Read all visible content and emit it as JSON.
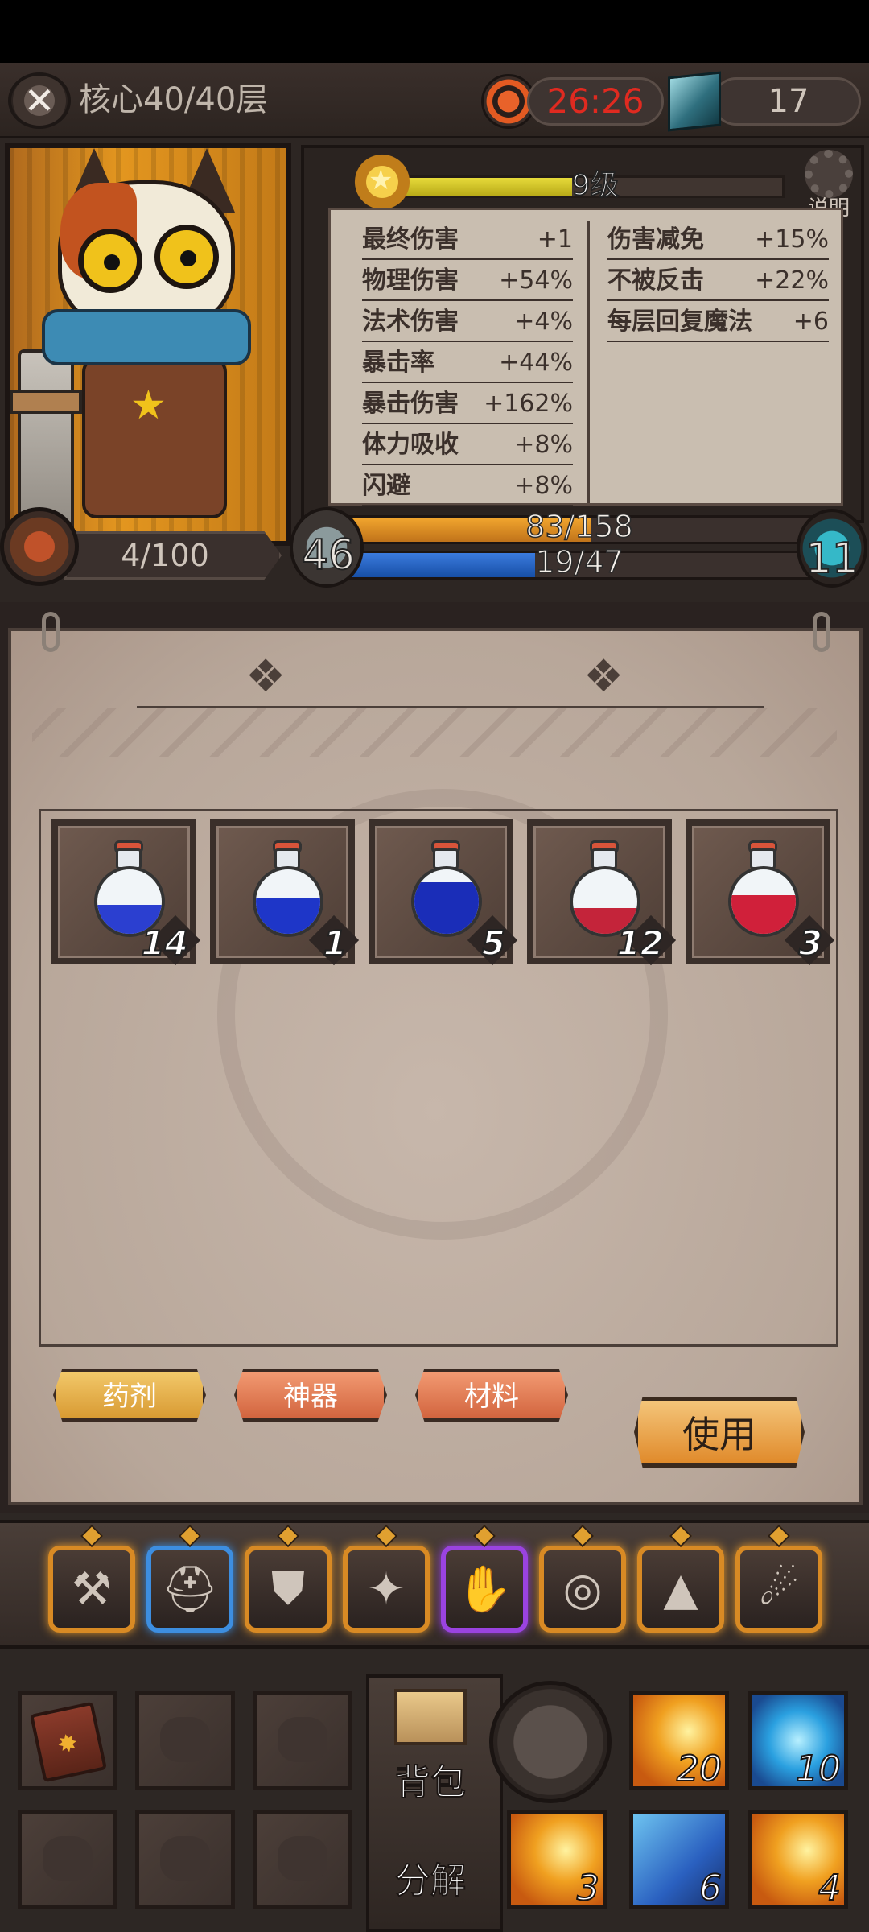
{
  "header": {
    "floor": "核心40/40层",
    "timer": "26:26",
    "gems": "17"
  },
  "character": {
    "level_label": "9级",
    "level_progress": 0.45,
    "explain_label": "说明",
    "exp": "4/100",
    "attack": "46",
    "defense": "11",
    "hp": {
      "text": "83/158",
      "fraction": 0.525
    },
    "mp": {
      "text": "19/47",
      "fraction": 0.404
    }
  },
  "stats_left": [
    {
      "name": "最终伤害",
      "value": "+1"
    },
    {
      "name": "物理伤害",
      "value": "+54%"
    },
    {
      "name": "法术伤害",
      "value": "+4%"
    },
    {
      "name": "暴击率",
      "value": "+44%"
    },
    {
      "name": "暴击伤害",
      "value": "+162%"
    },
    {
      "name": "体力吸收",
      "value": "+8%"
    },
    {
      "name": "闪避",
      "value": "+8%"
    }
  ],
  "stats_right": [
    {
      "name": "伤害减免",
      "value": "+15%"
    },
    {
      "name": "不被反击",
      "value": "+22%"
    },
    {
      "name": "每层回复魔法",
      "value": "+6"
    }
  ],
  "potions": [
    {
      "qty": "14",
      "color": "#2b3fd0",
      "fill": 0.45
    },
    {
      "qty": "1",
      "color": "#1e36c8",
      "fill": 0.55
    },
    {
      "qty": "5",
      "color": "#1a2db8",
      "fill": 0.8
    },
    {
      "qty": "12",
      "color": "#c4243a",
      "fill": 0.4
    },
    {
      "qty": "3",
      "color": "#d0203a",
      "fill": 0.6
    }
  ],
  "tabs": {
    "potion": "药剂",
    "artifact": "神器",
    "material": "材料"
  },
  "use_button": "使用",
  "bottom": {
    "bag": "背包",
    "decompose": "分解",
    "skills": [
      {
        "name": "fire-slash",
        "count": "20"
      },
      {
        "name": "ice-burst",
        "count": "10"
      },
      {
        "name": "flame",
        "count": "3"
      },
      {
        "name": "ice-blade",
        "count": "6"
      },
      {
        "name": "fire-wave",
        "count": "4"
      }
    ]
  },
  "equipment": [
    "axe",
    "helmet",
    "armor",
    "wings",
    "gloves",
    "ring",
    "boots",
    "amulet"
  ]
}
